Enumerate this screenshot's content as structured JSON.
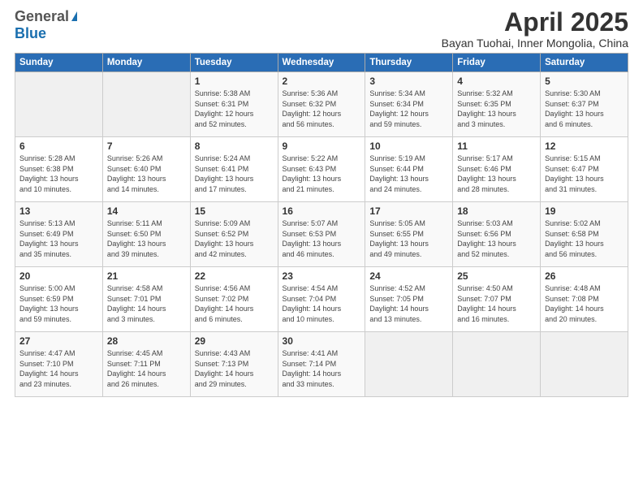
{
  "logo": {
    "general": "General",
    "blue": "Blue"
  },
  "title": {
    "month_year": "April 2025",
    "location": "Bayan Tuohai, Inner Mongolia, China"
  },
  "weekdays": [
    "Sunday",
    "Monday",
    "Tuesday",
    "Wednesday",
    "Thursday",
    "Friday",
    "Saturday"
  ],
  "weeks": [
    [
      {
        "day": "",
        "info": ""
      },
      {
        "day": "",
        "info": ""
      },
      {
        "day": "1",
        "info": "Sunrise: 5:38 AM\nSunset: 6:31 PM\nDaylight: 12 hours\nand 52 minutes."
      },
      {
        "day": "2",
        "info": "Sunrise: 5:36 AM\nSunset: 6:32 PM\nDaylight: 12 hours\nand 56 minutes."
      },
      {
        "day": "3",
        "info": "Sunrise: 5:34 AM\nSunset: 6:34 PM\nDaylight: 12 hours\nand 59 minutes."
      },
      {
        "day": "4",
        "info": "Sunrise: 5:32 AM\nSunset: 6:35 PM\nDaylight: 13 hours\nand 3 minutes."
      },
      {
        "day": "5",
        "info": "Sunrise: 5:30 AM\nSunset: 6:37 PM\nDaylight: 13 hours\nand 6 minutes."
      }
    ],
    [
      {
        "day": "6",
        "info": "Sunrise: 5:28 AM\nSunset: 6:38 PM\nDaylight: 13 hours\nand 10 minutes."
      },
      {
        "day": "7",
        "info": "Sunrise: 5:26 AM\nSunset: 6:40 PM\nDaylight: 13 hours\nand 14 minutes."
      },
      {
        "day": "8",
        "info": "Sunrise: 5:24 AM\nSunset: 6:41 PM\nDaylight: 13 hours\nand 17 minutes."
      },
      {
        "day": "9",
        "info": "Sunrise: 5:22 AM\nSunset: 6:43 PM\nDaylight: 13 hours\nand 21 minutes."
      },
      {
        "day": "10",
        "info": "Sunrise: 5:19 AM\nSunset: 6:44 PM\nDaylight: 13 hours\nand 24 minutes."
      },
      {
        "day": "11",
        "info": "Sunrise: 5:17 AM\nSunset: 6:46 PM\nDaylight: 13 hours\nand 28 minutes."
      },
      {
        "day": "12",
        "info": "Sunrise: 5:15 AM\nSunset: 6:47 PM\nDaylight: 13 hours\nand 31 minutes."
      }
    ],
    [
      {
        "day": "13",
        "info": "Sunrise: 5:13 AM\nSunset: 6:49 PM\nDaylight: 13 hours\nand 35 minutes."
      },
      {
        "day": "14",
        "info": "Sunrise: 5:11 AM\nSunset: 6:50 PM\nDaylight: 13 hours\nand 39 minutes."
      },
      {
        "day": "15",
        "info": "Sunrise: 5:09 AM\nSunset: 6:52 PM\nDaylight: 13 hours\nand 42 minutes."
      },
      {
        "day": "16",
        "info": "Sunrise: 5:07 AM\nSunset: 6:53 PM\nDaylight: 13 hours\nand 46 minutes."
      },
      {
        "day": "17",
        "info": "Sunrise: 5:05 AM\nSunset: 6:55 PM\nDaylight: 13 hours\nand 49 minutes."
      },
      {
        "day": "18",
        "info": "Sunrise: 5:03 AM\nSunset: 6:56 PM\nDaylight: 13 hours\nand 52 minutes."
      },
      {
        "day": "19",
        "info": "Sunrise: 5:02 AM\nSunset: 6:58 PM\nDaylight: 13 hours\nand 56 minutes."
      }
    ],
    [
      {
        "day": "20",
        "info": "Sunrise: 5:00 AM\nSunset: 6:59 PM\nDaylight: 13 hours\nand 59 minutes."
      },
      {
        "day": "21",
        "info": "Sunrise: 4:58 AM\nSunset: 7:01 PM\nDaylight: 14 hours\nand 3 minutes."
      },
      {
        "day": "22",
        "info": "Sunrise: 4:56 AM\nSunset: 7:02 PM\nDaylight: 14 hours\nand 6 minutes."
      },
      {
        "day": "23",
        "info": "Sunrise: 4:54 AM\nSunset: 7:04 PM\nDaylight: 14 hours\nand 10 minutes."
      },
      {
        "day": "24",
        "info": "Sunrise: 4:52 AM\nSunset: 7:05 PM\nDaylight: 14 hours\nand 13 minutes."
      },
      {
        "day": "25",
        "info": "Sunrise: 4:50 AM\nSunset: 7:07 PM\nDaylight: 14 hours\nand 16 minutes."
      },
      {
        "day": "26",
        "info": "Sunrise: 4:48 AM\nSunset: 7:08 PM\nDaylight: 14 hours\nand 20 minutes."
      }
    ],
    [
      {
        "day": "27",
        "info": "Sunrise: 4:47 AM\nSunset: 7:10 PM\nDaylight: 14 hours\nand 23 minutes."
      },
      {
        "day": "28",
        "info": "Sunrise: 4:45 AM\nSunset: 7:11 PM\nDaylight: 14 hours\nand 26 minutes."
      },
      {
        "day": "29",
        "info": "Sunrise: 4:43 AM\nSunset: 7:13 PM\nDaylight: 14 hours\nand 29 minutes."
      },
      {
        "day": "30",
        "info": "Sunrise: 4:41 AM\nSunset: 7:14 PM\nDaylight: 14 hours\nand 33 minutes."
      },
      {
        "day": "",
        "info": ""
      },
      {
        "day": "",
        "info": ""
      },
      {
        "day": "",
        "info": ""
      }
    ]
  ]
}
